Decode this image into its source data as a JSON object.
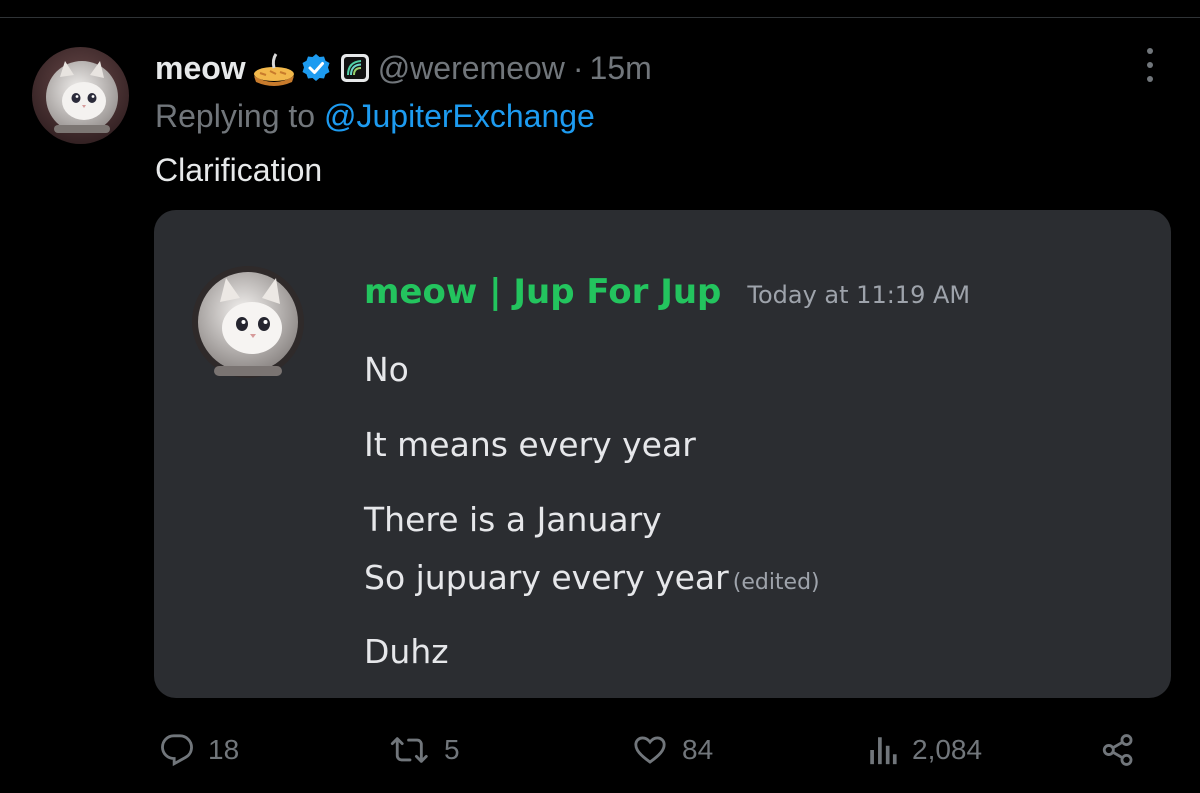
{
  "tweet": {
    "author_name": "meow",
    "author_handle": "@weremeow",
    "time_ago": "15m",
    "separator": "·",
    "replying_prefix": "Replying to",
    "replying_to": "@JupiterExchange",
    "text": "Clarification"
  },
  "embed": {
    "author_name": "meow | Jup For Jup",
    "timestamp": "Today at 11:19 AM",
    "lines": [
      "No",
      "It means every year",
      "There is a January",
      "So jupuary every year",
      "Duhz"
    ],
    "edited_label": "(edited)",
    "name_color": "#23c45e"
  },
  "actions": {
    "replies": "18",
    "reposts": "5",
    "likes": "84",
    "views": "2,084"
  },
  "icons": [
    "pie-emoji-icon",
    "verified-badge-icon",
    "affiliate-badge-icon",
    "more-icon",
    "reply-icon",
    "repost-icon",
    "like-icon",
    "views-icon",
    "share-icon"
  ],
  "colors": {
    "background": "#000000",
    "link": "#1d9bf0",
    "muted": "#71767b",
    "card": "#2b2d31",
    "verified": "#1d9bf0"
  }
}
